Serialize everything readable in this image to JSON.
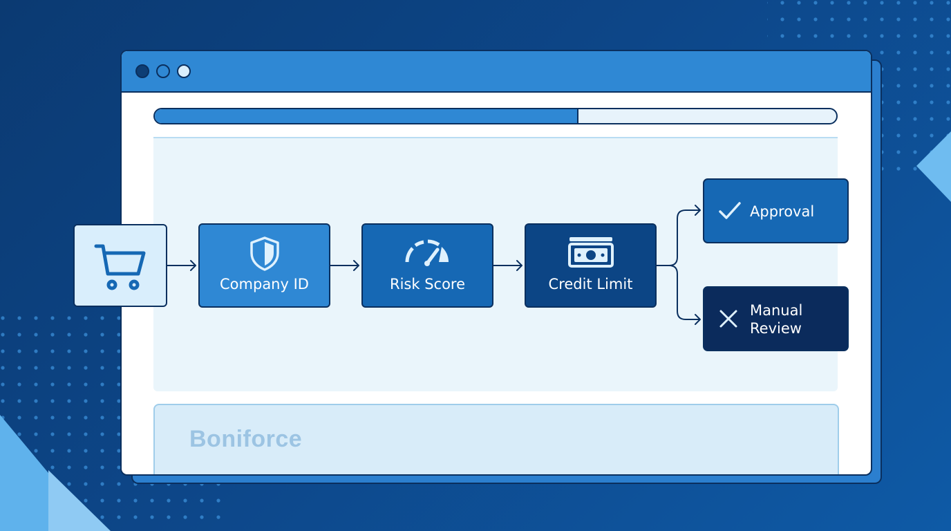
{
  "window": {
    "controls": [
      "close-dot",
      "minimize-dot",
      "maximize-dot"
    ],
    "progress": 0.62
  },
  "flow": {
    "start": {
      "icon": "shopping-cart-icon"
    },
    "steps": [
      {
        "label": "Company ID",
        "icon": "shield-icon"
      },
      {
        "label": "Risk Score",
        "icon": "gauge-icon"
      },
      {
        "label": "Credit Limit",
        "icon": "banknote-icon"
      }
    ],
    "outcomes": [
      {
        "label": "Approval",
        "icon": "checkmark-icon"
      },
      {
        "label_line1": "Manual",
        "label_line2": "Review",
        "icon": "x-icon"
      }
    ]
  },
  "footer": {
    "brand": "Boniforce"
  },
  "colors": {
    "accent": "#2f88d4",
    "dark": "#0a2f5e",
    "approval": "#1668b4",
    "manual_review": "#0b2b5c"
  }
}
